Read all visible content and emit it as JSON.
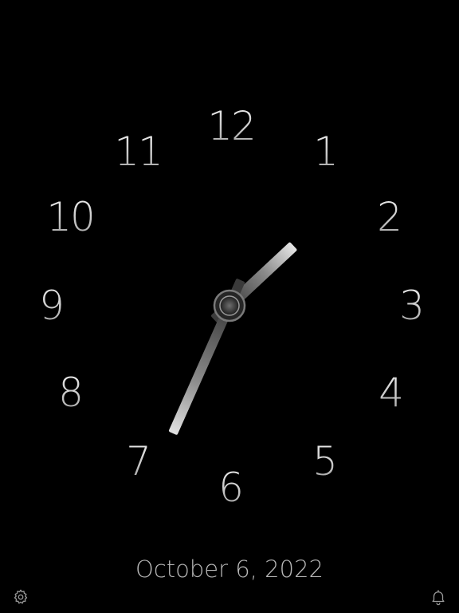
{
  "clock": {
    "numerals": [
      "12",
      "1",
      "2",
      "3",
      "4",
      "5",
      "6",
      "7",
      "8",
      "9",
      "10",
      "11"
    ],
    "time": {
      "hour": 1,
      "minute": 34
    },
    "colors": {
      "background": "#000000",
      "numeral": "#d8d8d8",
      "hand_light": "#e0e0e0",
      "hand_dark": "#3a3a3a"
    }
  },
  "date": {
    "text": "October 6, 2022"
  },
  "toolbar": {
    "settings_icon": "gear-icon",
    "alarm_icon": "bell-icon"
  }
}
